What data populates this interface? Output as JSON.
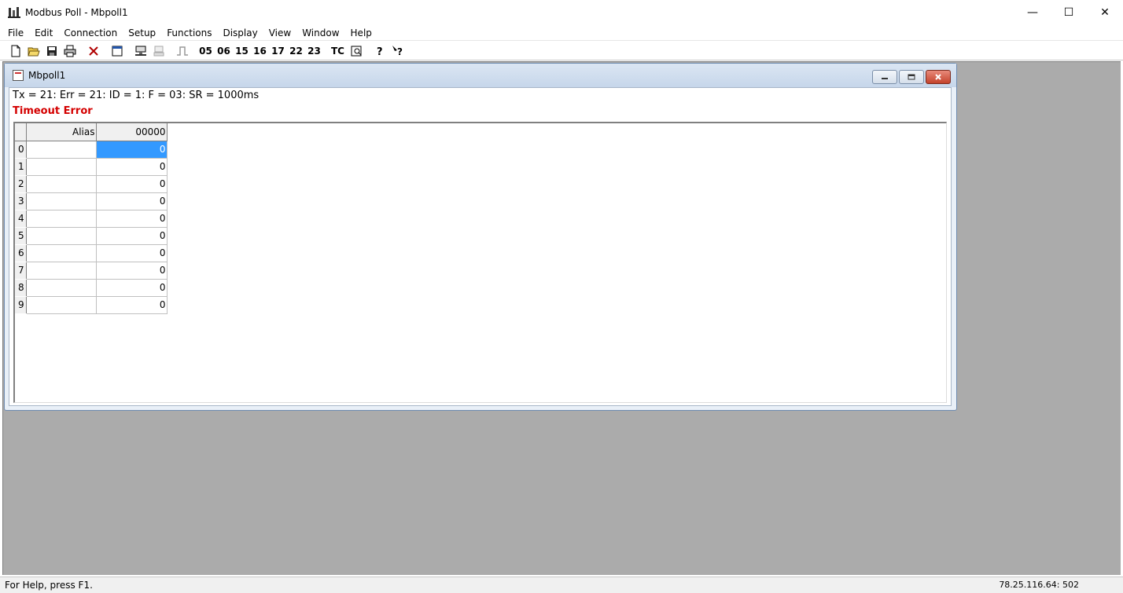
{
  "window": {
    "title": "Modbus Poll - Mbpoll1",
    "controls": {
      "minimize": "—",
      "maximize": "☐",
      "close": "✕"
    }
  },
  "menu": [
    "File",
    "Edit",
    "Connection",
    "Setup",
    "Functions",
    "Display",
    "View",
    "Window",
    "Help"
  ],
  "toolbar": {
    "func_codes": [
      "05",
      "06",
      "15",
      "16",
      "17",
      "22",
      "23"
    ],
    "tc_label": "TC",
    "icons": [
      "new-icon",
      "open-icon",
      "save-icon",
      "print-icon",
      "delete-icon",
      "window-icon",
      "connect-icon",
      "disconnect-icon",
      "pulse-icon",
      "traffic-icon",
      "help-icon",
      "context-help-icon"
    ]
  },
  "child_window": {
    "title": "Mbpoll1",
    "status_line": "Tx = 21: Err = 21: ID = 1: F = 03: SR = 1000ms",
    "error_line": "Timeout Error",
    "grid": {
      "columns": [
        "Alias",
        "00000"
      ],
      "rows": [
        {
          "num": "0",
          "alias": "",
          "value": "0"
        },
        {
          "num": "1",
          "alias": "",
          "value": "0"
        },
        {
          "num": "2",
          "alias": "",
          "value": "0"
        },
        {
          "num": "3",
          "alias": "",
          "value": "0"
        },
        {
          "num": "4",
          "alias": "",
          "value": "0"
        },
        {
          "num": "5",
          "alias": "",
          "value": "0"
        },
        {
          "num": "6",
          "alias": "",
          "value": "0"
        },
        {
          "num": "7",
          "alias": "",
          "value": "0"
        },
        {
          "num": "8",
          "alias": "",
          "value": "0"
        },
        {
          "num": "9",
          "alias": "",
          "value": "0"
        }
      ]
    }
  },
  "statusbar": {
    "help": "For Help, press F1.",
    "connection": "78.25.116.64: 502"
  },
  "colors": {
    "selection": "#3399ff",
    "error_text": "#d40000",
    "mdi_background": "#ababab"
  }
}
